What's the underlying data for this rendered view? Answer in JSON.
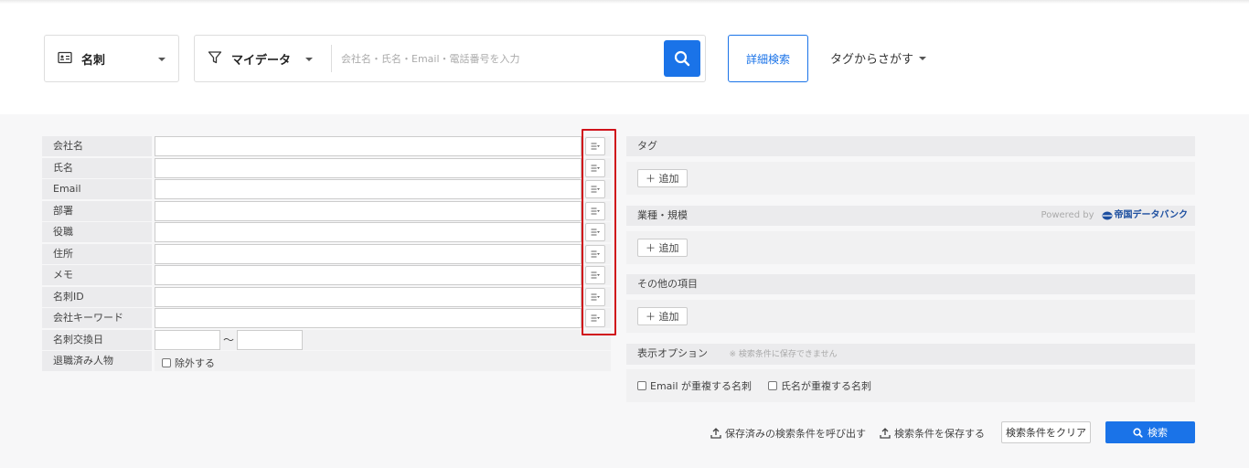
{
  "header": {
    "card_type": "名刺",
    "filter_label": "マイデータ",
    "search_placeholder": "会社名・氏名・Email・電話番号を入力",
    "advanced_search": "詳細検索",
    "tag_search": "タグからさがす"
  },
  "form": {
    "fields": [
      "会社名",
      "氏名",
      "Email",
      "部署",
      "役職",
      "住所",
      "メモ",
      "名刺ID",
      "会社キーワード"
    ],
    "exchange_date_label": "名刺交換日",
    "exchange_date_separator": "〜",
    "retired_label": "退職済み人物",
    "retired_checkbox": "除外する"
  },
  "right": {
    "tag": {
      "title": "タグ",
      "add": "＋ 追加"
    },
    "industry": {
      "title": "業種・規模",
      "powered_by": "Powered by",
      "provider": "帝国データバンク",
      "add": "＋ 追加"
    },
    "other": {
      "title": "その他の項目",
      "add": "＋ 追加"
    },
    "display_options": {
      "title": "表示オプション",
      "note": "※ 検索条件に保存できません",
      "opt_email": "Email が重複する名刺",
      "opt_name": "氏名が重複する名刺"
    }
  },
  "footer": {
    "load_saved": "保存済みの検索条件を呼び出す",
    "save": "検索条件を保存する",
    "clear": "検索条件をクリア",
    "search": "検索"
  },
  "colors": {
    "accent": "#1a73e8",
    "highlight_frame": "#d0121b"
  }
}
